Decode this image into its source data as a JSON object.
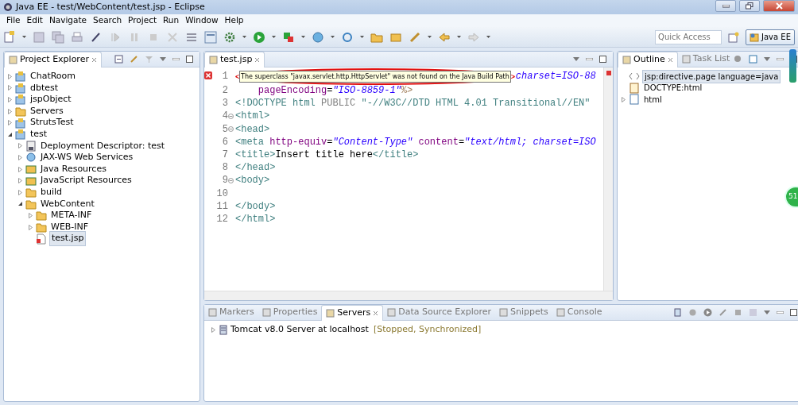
{
  "window": {
    "title": "Java EE - test/WebContent/test.jsp - Eclipse"
  },
  "menu": [
    "File",
    "Edit",
    "Navigate",
    "Search",
    "Project",
    "Run",
    "Window",
    "Help"
  ],
  "quick_access": {
    "placeholder": "Quick Access"
  },
  "perspective": {
    "label": "Java EE",
    "selected": true
  },
  "project_explorer": {
    "tabs": [
      {
        "label": "Project Explorer",
        "selected": true
      }
    ],
    "tree": [
      {
        "label": "ChatRoom",
        "kind": "project",
        "expanded": false,
        "selected": false
      },
      {
        "label": "dbtest",
        "kind": "project",
        "expanded": false,
        "selected": false
      },
      {
        "label": "jspObject",
        "kind": "project",
        "expanded": false,
        "selected": false
      },
      {
        "label": "Servers",
        "kind": "folder",
        "expanded": false,
        "selected": false
      },
      {
        "label": "StrutsTest",
        "kind": "project",
        "expanded": false,
        "selected": false
      },
      {
        "label": "test",
        "kind": "project",
        "expanded": true,
        "selected": false,
        "children": [
          {
            "label": "Deployment Descriptor: test",
            "kind": "descriptor",
            "expanded": false,
            "selected": false
          },
          {
            "label": "JAX-WS Web Services",
            "kind": "services",
            "expanded": false,
            "selected": false
          },
          {
            "label": "Java Resources",
            "kind": "resources",
            "expanded": false,
            "selected": false
          },
          {
            "label": "JavaScript Resources",
            "kind": "resources",
            "expanded": false,
            "selected": false
          },
          {
            "label": "build",
            "kind": "folder",
            "expanded": false,
            "selected": false
          },
          {
            "label": "WebContent",
            "kind": "folder",
            "expanded": true,
            "selected": false,
            "children": [
              {
                "label": "META-INF",
                "kind": "folder",
                "expanded": false,
                "selected": false
              },
              {
                "label": "WEB-INF",
                "kind": "folder",
                "expanded": false,
                "selected": false
              },
              {
                "label": "test.jsp",
                "kind": "file",
                "selected": true
              }
            ]
          }
        ]
      }
    ]
  },
  "editor": {
    "tabs": [
      {
        "label": "test.jsp",
        "selected": true
      }
    ],
    "tooltip": "The superclass \"javax.servlet.http.HttpServlet\" was not found on the Java Build Path",
    "lines": [
      {
        "number": "1",
        "error": true,
        "fold": false,
        "segments": [
          {
            "kind": "string",
            "text": "charset=ISO-88"
          }
        ]
      },
      {
        "number": "2",
        "error": false,
        "fold": false,
        "segments": [
          {
            "kind": "attr",
            "text": "    pageEncoding"
          },
          {
            "kind": "text",
            "text": "="
          },
          {
            "kind": "string",
            "text": "\"ISO-8859-1\""
          },
          {
            "kind": "jsp",
            "text": "%>"
          }
        ]
      },
      {
        "number": "3",
        "error": false,
        "fold": false,
        "segments": [
          {
            "kind": "tag",
            "text": "<!DOCTYPE html "
          },
          {
            "kind": "keyword",
            "text": "PUBLIC "
          },
          {
            "kind": "tag",
            "text": "\"-//W3C//DTD HTML 4.01 Transitional//EN\""
          }
        ]
      },
      {
        "number": "4",
        "error": false,
        "fold": true,
        "segments": [
          {
            "kind": "tag",
            "text": "<html>"
          }
        ]
      },
      {
        "number": "5",
        "error": false,
        "fold": true,
        "segments": [
          {
            "kind": "tag",
            "text": "<head>"
          }
        ]
      },
      {
        "number": "6",
        "error": false,
        "fold": false,
        "segments": [
          {
            "kind": "tag",
            "text": "<meta"
          },
          {
            "kind": "attr",
            "text": " http-equiv"
          },
          {
            "kind": "text",
            "text": "="
          },
          {
            "kind": "string",
            "text": "\"Content-Type\""
          },
          {
            "kind": "attr",
            "text": " content"
          },
          {
            "kind": "text",
            "text": "="
          },
          {
            "kind": "string",
            "text": "\"text/html; charset=ISO"
          }
        ]
      },
      {
        "number": "7",
        "error": false,
        "fold": false,
        "segments": [
          {
            "kind": "tag",
            "text": "<title>"
          },
          {
            "kind": "text",
            "text": "Insert title here"
          },
          {
            "kind": "tag",
            "text": "</title>"
          }
        ]
      },
      {
        "number": "8",
        "error": false,
        "fold": false,
        "segments": [
          {
            "kind": "tag",
            "text": "</head>"
          }
        ]
      },
      {
        "number": "9",
        "error": false,
        "fold": true,
        "segments": [
          {
            "kind": "tag",
            "text": "<body>"
          }
        ]
      },
      {
        "number": "10",
        "error": false,
        "fold": false
      },
      {
        "number": "11",
        "error": false,
        "fold": false,
        "segments": [
          {
            "kind": "tag",
            "text": "</body>"
          }
        ]
      },
      {
        "number": "12",
        "error": false,
        "fold": false,
        "segments": [
          {
            "kind": "tag",
            "text": "</html>"
          }
        ]
      }
    ]
  },
  "outline": {
    "tabs": [
      {
        "label": "Outline",
        "selected": true
      },
      {
        "label": "Task List",
        "selected": false
      }
    ],
    "tree": [
      {
        "label": "jsp:directive.page language=java",
        "kind": "directive",
        "selected": true
      },
      {
        "label": "DOCTYPE:html",
        "kind": "doctype",
        "selected": false
      },
      {
        "label": "html",
        "kind": "element",
        "expanded": false,
        "selected": false
      }
    ]
  },
  "bottom_panel": {
    "tabs": [
      {
        "label": "Markers",
        "selected": false
      },
      {
        "label": "Properties",
        "selected": false
      },
      {
        "label": "Servers",
        "selected": true
      },
      {
        "label": "Data Source Explorer",
        "selected": false
      },
      {
        "label": "Snippets",
        "selected": false
      },
      {
        "label": "Console",
        "selected": false
      }
    ],
    "servers": [
      {
        "name": "Tomcat v8.0 Server at localhost",
        "status": "[Stopped, Synchronized]",
        "expanded": false
      }
    ]
  },
  "floating_badge": "51"
}
